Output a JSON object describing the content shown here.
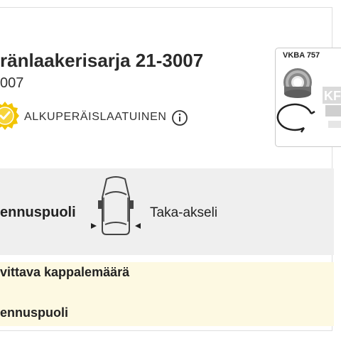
{
  "product": {
    "title": "ränlaakerisarja 21-3007",
    "subtitle": "007",
    "badge_text": "ALKUPERÄISLAATUINEN",
    "badge_icon": "quality-seal-icon",
    "info_icon": "info-icon",
    "accent_color": "#f2c400"
  },
  "thumbnail": {
    "label": "VKBA 757",
    "icons": [
      "wheel-bearing-icon",
      "retaining-ring-icon"
    ]
  },
  "fitment": {
    "side_label": "ennuspuoli",
    "axle_label": "Taka-akseli",
    "car_icon": "car-top-view-icon",
    "panel_color": "#efefef"
  },
  "details": {
    "quantity_label": "vittava kappalemäärä",
    "side_label": "ennuspuoli",
    "panel_color": "#fdf9e2"
  }
}
